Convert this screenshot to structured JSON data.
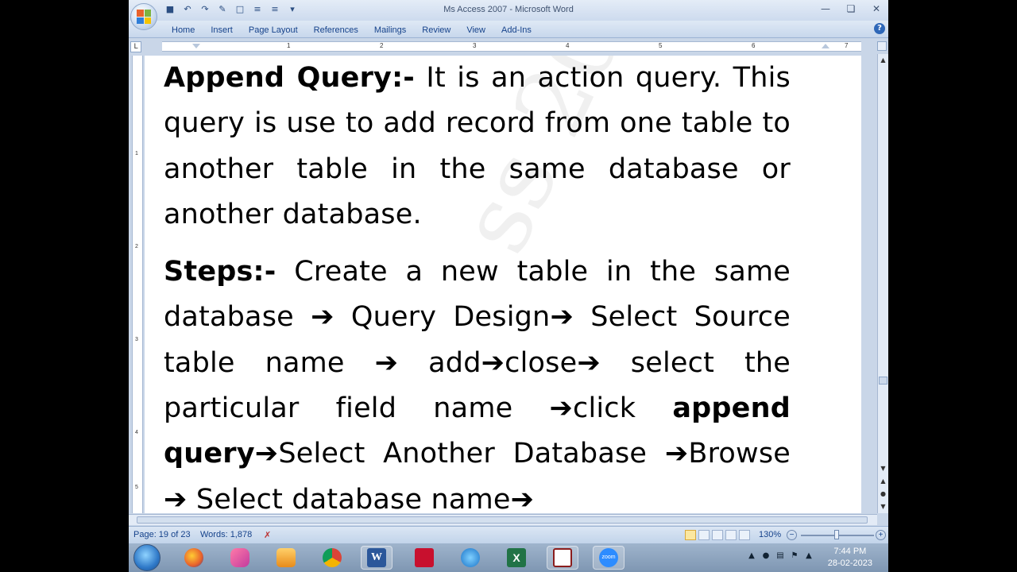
{
  "window": {
    "title": "Ms Access 2007  -  Microsoft Word",
    "minimize": "—",
    "restore": "❏",
    "close": "✕"
  },
  "quick_access": [
    "save-icon",
    "undo-icon",
    "redo-icon",
    "format-painter-icon",
    "customize-icon"
  ],
  "ribbon": {
    "tabs": [
      "Home",
      "Insert",
      "Page Layout",
      "References",
      "Mailings",
      "Review",
      "View",
      "Add-Ins"
    ],
    "help": "?"
  },
  "ruler": {
    "numbers": [
      "1",
      "2",
      "3",
      "4",
      "5",
      "6",
      "7"
    ],
    "vertical_numbers": [
      "1",
      "2",
      "3",
      "4",
      "5"
    ],
    "tab_selector": "L"
  },
  "document": {
    "para1": {
      "heading": "Append Query:-",
      "text": " It is an action query. This query is use to add record from one table to another table in the same database or another database."
    },
    "para2": {
      "heading": "Steps:-",
      "t1": " Create a new table in the same database ",
      "t2": " Query Design",
      "t3": " Select Source table name ",
      "t4": " add",
      "t5": "close",
      "t6": " select the particular field name ",
      "t7": "click ",
      "b1": "append query",
      "t8": "Select Another Database ",
      "t9": "Browse ",
      "t10": " Select database name",
      "arrow": "➔"
    },
    "watermark": "ss 2007"
  },
  "statusbar": {
    "page": "Page: 19 of 23",
    "words": "Words: 1,878",
    "zoom": "130%",
    "zoom_out": "−",
    "zoom_in": "+"
  },
  "taskbar": {
    "icons": [
      "start-icon",
      "firefox-icon",
      "winamp-icon",
      "media-player-icon",
      "chrome-icon",
      "word-icon",
      "acrobat-icon",
      "ie-icon",
      "excel-icon",
      "access-icon",
      "zoom-icon"
    ],
    "zoom_label": "zoom",
    "clock_time": "7:44 PM",
    "clock_date": "28-02-2023"
  },
  "colors": {
    "accent": "#15428b",
    "word_blue": "#2b579a",
    "excel_green": "#217346",
    "acrobat_red": "#c8102e"
  }
}
